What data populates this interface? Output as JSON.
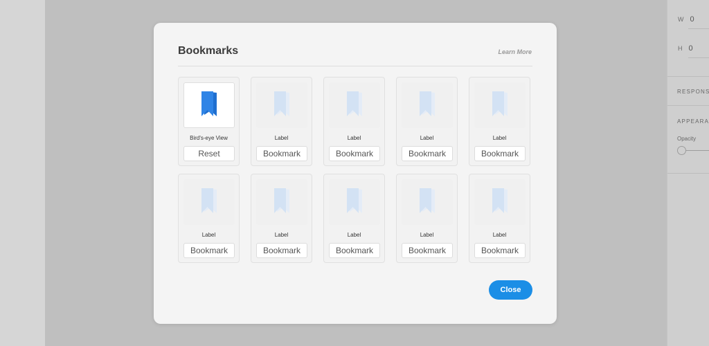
{
  "background": {
    "right_panel": {
      "w_label": "W",
      "w_value": "0",
      "h_label": "H",
      "h_value": "0",
      "section_responsive": "RESPONSI",
      "section_appearance": "APPEARAN",
      "opacity_label": "Opacity"
    }
  },
  "modal": {
    "title": "Bookmarks",
    "learn_more": "Learn More",
    "close_label": "Close",
    "bookmarks": [
      {
        "label": "Bird's-eye View",
        "button": "Reset",
        "active": true
      },
      {
        "label": "Label",
        "button": "Bookmark",
        "active": false
      },
      {
        "label": "Label",
        "button": "Bookmark",
        "active": false
      },
      {
        "label": "Label",
        "button": "Bookmark",
        "active": false
      },
      {
        "label": "Label",
        "button": "Bookmark",
        "active": false
      },
      {
        "label": "Label",
        "button": "Bookmark",
        "active": false
      },
      {
        "label": "Label",
        "button": "Bookmark",
        "active": false
      },
      {
        "label": "Label",
        "button": "Bookmark",
        "active": false
      },
      {
        "label": "Label",
        "button": "Bookmark",
        "active": false
      },
      {
        "label": "Label",
        "button": "Bookmark",
        "active": false
      }
    ]
  },
  "colors": {
    "accent": "#1b8ee6",
    "bookmark_active": "#2f84e6",
    "bookmark_inactive": "#d3e2f4"
  },
  "icons": {
    "bookmark": "bookmark-icon",
    "slider": "opacity-slider"
  }
}
